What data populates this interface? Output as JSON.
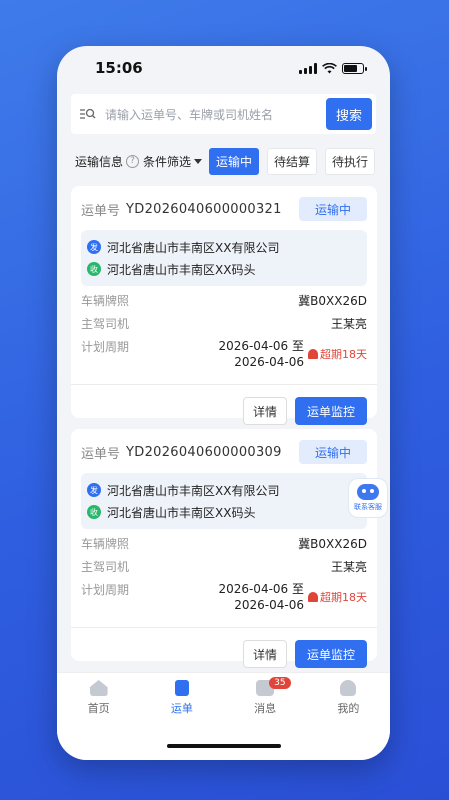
{
  "status_bar": {
    "time": "15:06"
  },
  "search": {
    "placeholder": "请输入运单号、车牌或司机姓名",
    "button": "搜索"
  },
  "filters": {
    "label": "运输信息",
    "condition": "条件筛选",
    "chips": [
      {
        "label": "运输中",
        "active": true
      },
      {
        "label": "待结算",
        "active": false
      },
      {
        "label": "待执行",
        "active": false
      }
    ]
  },
  "orders": [
    {
      "waybill_label": "运单号",
      "waybill_no": "YD2026040600000321",
      "status": "运输中",
      "from_tag": "发",
      "from": "河北省唐山市丰南区XX有限公司",
      "to_tag": "收",
      "to": "河北省唐山市丰南区XX码头",
      "plate_label": "车辆牌照",
      "plate": "冀B0XX26D",
      "driver_label": "主驾司机",
      "driver": "王某亮",
      "period_label": "计划周期",
      "period_start": "2026-04-06 至",
      "period_end": "2026-04-06",
      "overdue": "超期18天",
      "detail_button": "详情",
      "monitor_button": "运单监控"
    },
    {
      "waybill_label": "运单号",
      "waybill_no": "YD2026040600000309",
      "status": "运输中",
      "from_tag": "发",
      "from": "河北省唐山市丰南区XX有限公司",
      "to_tag": "收",
      "to": "河北省唐山市丰南区XX码头",
      "plate_label": "车辆牌照",
      "plate": "冀B0XX26D",
      "driver_label": "主驾司机",
      "driver": "王某亮",
      "period_label": "计划周期",
      "period_start": "2026-04-06 至",
      "period_end": "2026-04-06",
      "overdue": "超期18天",
      "detail_button": "详情",
      "monitor_button": "运单监控"
    }
  ],
  "assistant": {
    "label": "联系客服"
  },
  "tabbar": {
    "items": [
      {
        "label": "首页",
        "icon": "home-icon"
      },
      {
        "label": "运单",
        "icon": "waybill-icon",
        "active": true
      },
      {
        "label": "消息",
        "icon": "message-icon",
        "badge": "35"
      },
      {
        "label": "我的",
        "icon": "profile-icon"
      }
    ]
  },
  "colors": {
    "primary": "#2f6ff0",
    "danger": "#e0453a",
    "success": "#27b86b"
  }
}
